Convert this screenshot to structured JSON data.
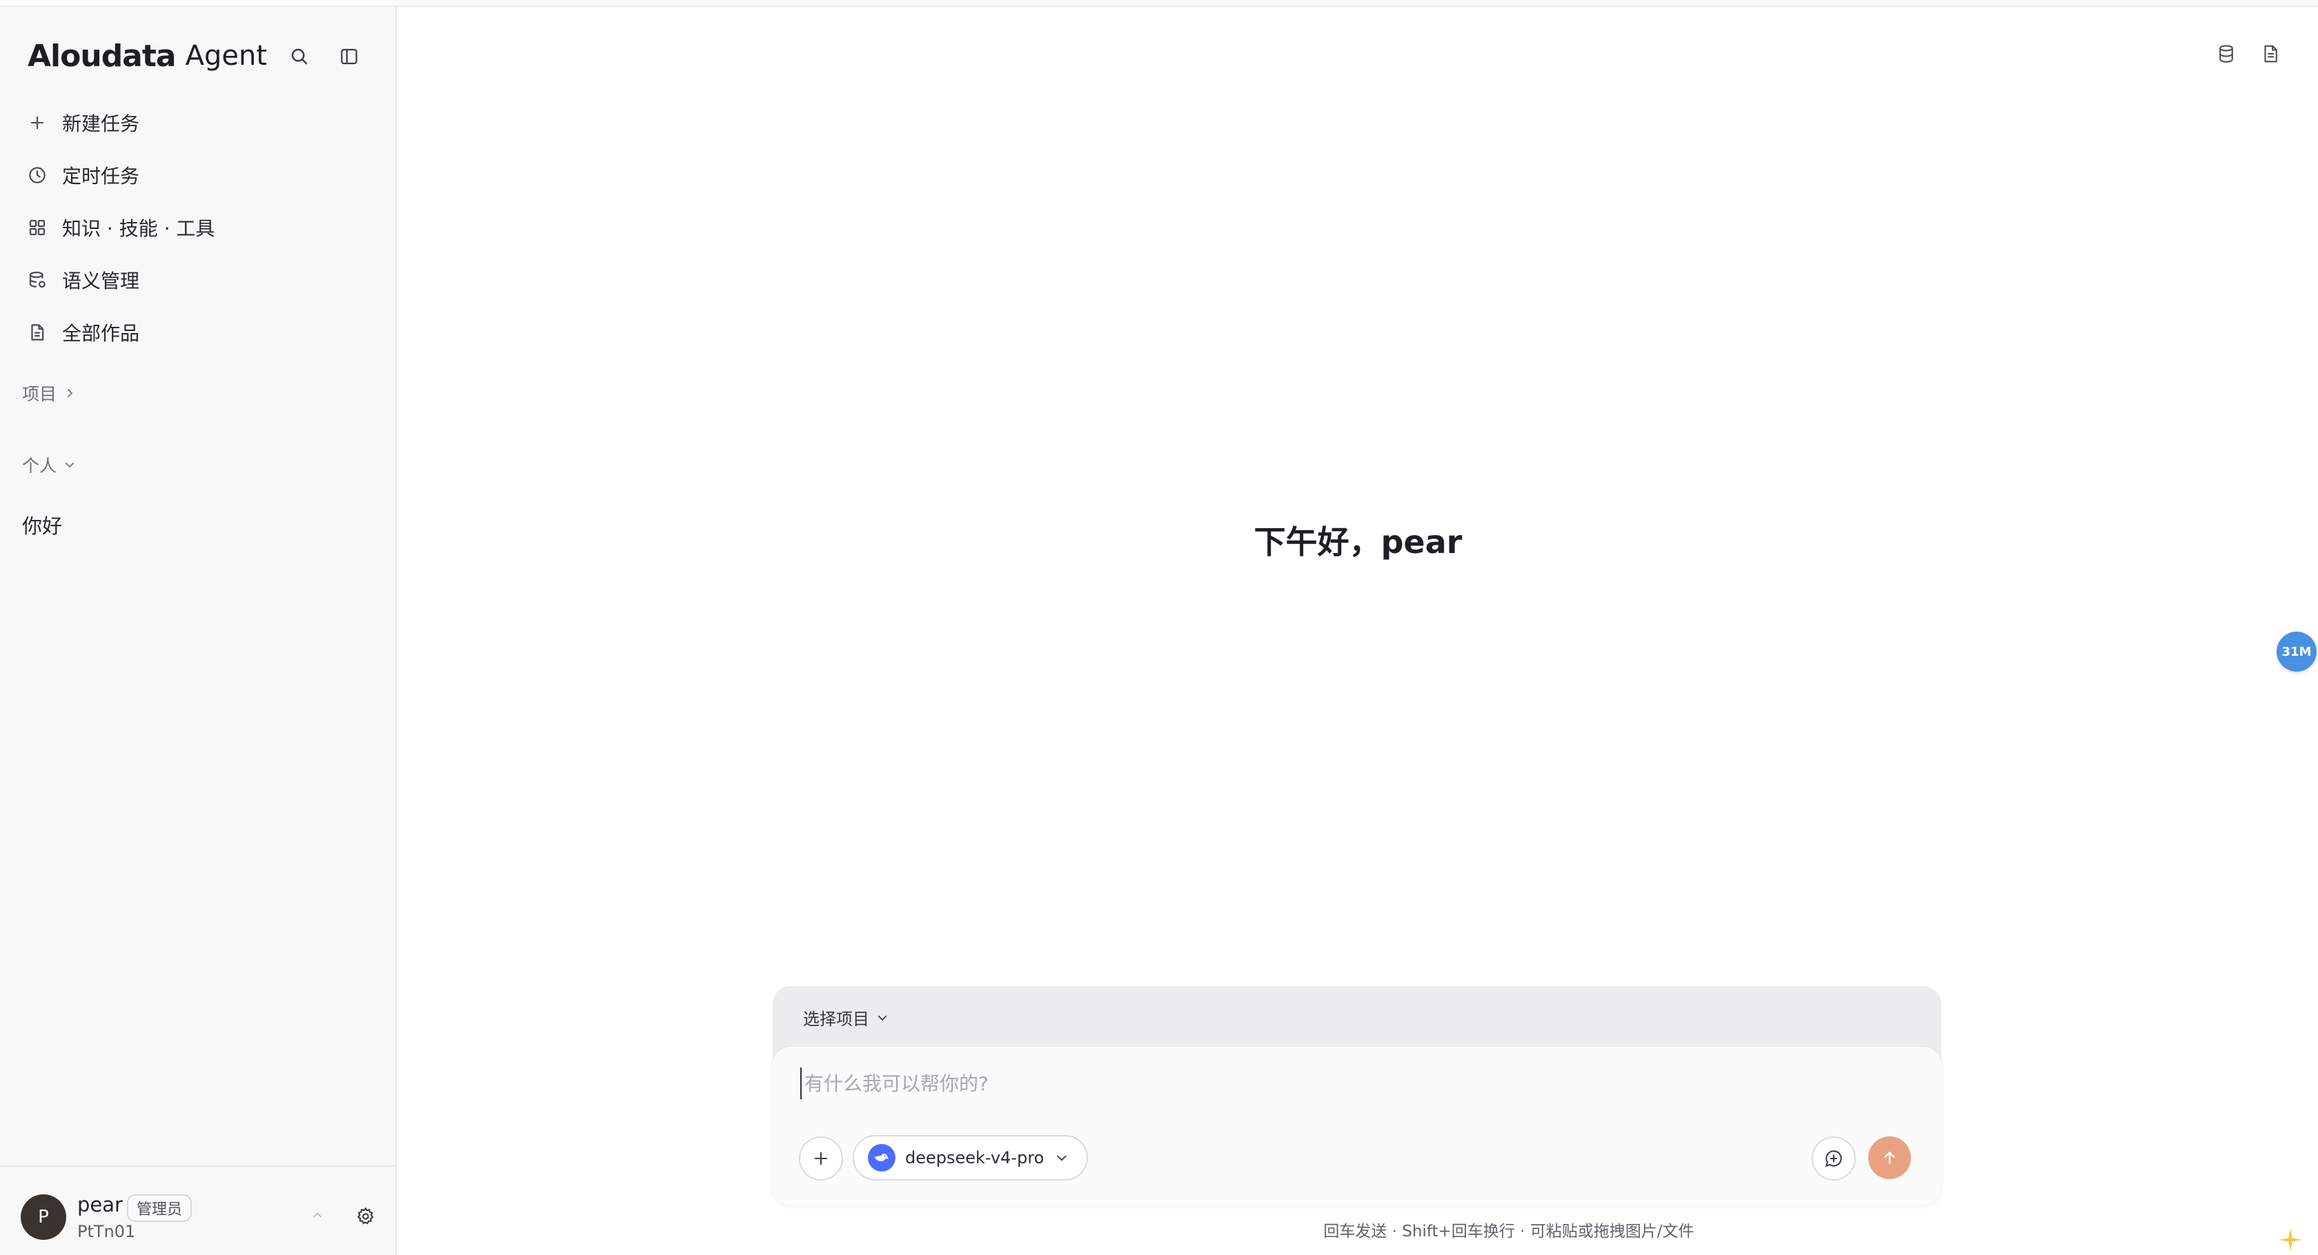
{
  "app": {
    "logo_main": "Aloudata",
    "logo_sub": "Agent"
  },
  "sidebar": {
    "search_icon": "search-icon",
    "collapse_icon": "sidebar-toggle-icon",
    "nav": [
      {
        "label": "新建任务",
        "icon": "plus-icon"
      },
      {
        "label": "定时任务",
        "icon": "clock-icon"
      },
      {
        "label": "知识 · 技能 · 工具",
        "icon": "grid-icon"
      },
      {
        "label": "语义管理",
        "icon": "database-settings-icon"
      },
      {
        "label": "全部作品",
        "icon": "document-icon"
      }
    ],
    "projects_label": "项目",
    "personal_label": "个人",
    "conversations": [
      "你好"
    ]
  },
  "user": {
    "avatar_letter": "P",
    "name": "pear",
    "role": "管理员",
    "id": "PtTn01"
  },
  "main": {
    "greeting": "下午好，pear",
    "float_badge": "31M",
    "top_icons": [
      "database-icon",
      "file-icon"
    ]
  },
  "composer": {
    "project_picker": "选择项目",
    "placeholder": "有什么我可以帮你的?",
    "value": "",
    "model": "deepseek-v4-pro",
    "hint": "回车发送 · Shift+回车换行 · 可粘贴或拖拽图片/文件"
  },
  "colors": {
    "sidebar_bg": "#f8f8f9",
    "send_button": "#e8a282",
    "badge_blue": "#4a90e2",
    "model_logo": "#4d6bfe"
  }
}
